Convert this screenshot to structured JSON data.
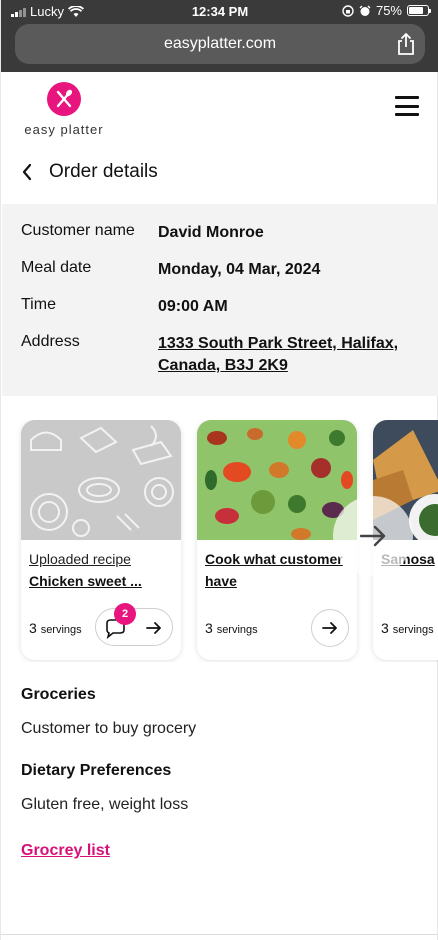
{
  "status_bar": {
    "carrier": "Lucky",
    "time": "12:34 PM",
    "battery": "75%",
    "battery_level": 0.75
  },
  "browser": {
    "url": "easyplatter.com"
  },
  "header": {
    "logo_text": "easy platter"
  },
  "page": {
    "title": "Order details"
  },
  "order": {
    "customer_label": "Customer name",
    "customer_value": "David Monroe",
    "meal_date_label": "Meal date",
    "meal_date_value": "Monday, 04 Mar, 2024",
    "time_label": "Time",
    "time_value": "09:00 AM",
    "address_label": "Address",
    "address_line1": "1333 South Park Street, Halifax,",
    "address_line2": "Canada, B3J 2K9"
  },
  "cards": [
    {
      "subtitle": "Uploaded recipe",
      "title": "Chicken sweet ...",
      "servings_num": "3",
      "servings_unit": "servings",
      "badge": "2"
    },
    {
      "title_line1": "Cook what customer",
      "title_line2": "have",
      "servings_num": "3",
      "servings_unit": "servings"
    },
    {
      "title": "Samosa",
      "servings_num": "3",
      "servings_unit": "servings"
    }
  ],
  "sections": {
    "groceries_heading": "Groceries",
    "groceries_text": "Customer to buy grocery",
    "dietary_heading": "Dietary Preferences",
    "dietary_text": "Gluten free, weight loss",
    "grocery_link": "Grocrey list"
  },
  "colors": {
    "brand_pink": "#e8157f",
    "link_pink": "#d6127a",
    "chrome_dark": "#3a3a3a"
  }
}
